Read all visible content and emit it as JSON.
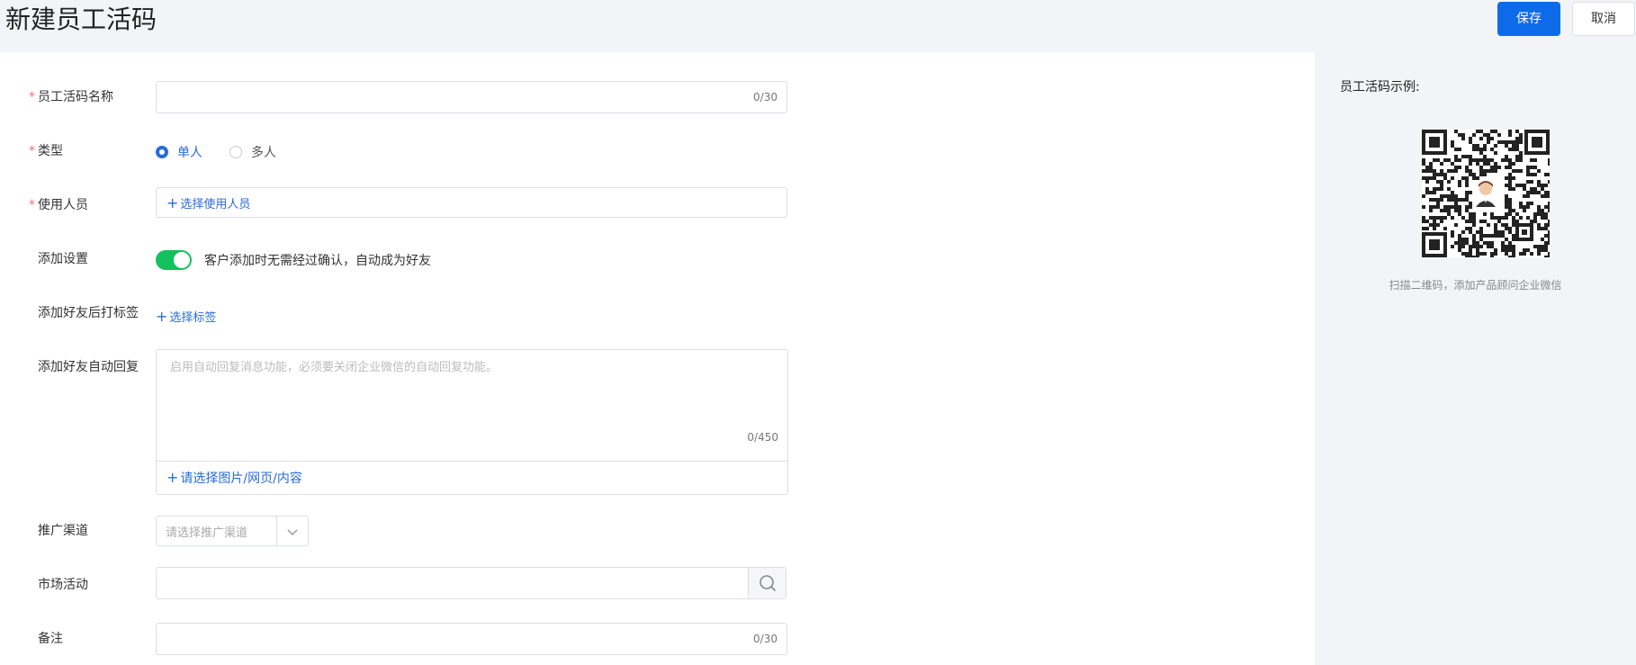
{
  "header": {
    "title": "新建员工活码",
    "save_label": "保存",
    "cancel_label": "取消"
  },
  "form": {
    "name": {
      "label": "员工活码名称",
      "required_mark": "*",
      "value": "",
      "counter": "0/30"
    },
    "type": {
      "label": "类型",
      "required_mark": "*",
      "options": [
        "单人",
        "多人"
      ],
      "selected": "单人"
    },
    "users": {
      "label": "使用人员",
      "required_mark": "*",
      "add_label": "选择使用人员"
    },
    "add_setting": {
      "label": "添加设置",
      "toggle_on": true,
      "toggle_text": "客户添加时无需经过确认，自动成为好友"
    },
    "tags": {
      "label": "添加好友后打标签",
      "add_label": "选择标签"
    },
    "auto_reply": {
      "label": "添加好友自动回复",
      "placeholder": "启用自动回复消息功能，必须要关闭企业微信的自动回复功能。",
      "counter": "0/450",
      "attach_label": "请选择图片/网页/内容"
    },
    "channel": {
      "label": "推广渠道",
      "placeholder": "请选择推广渠道"
    },
    "campaign": {
      "label": "市场活动",
      "value": ""
    },
    "remark": {
      "label": "备注",
      "value": "",
      "counter": "0/30"
    }
  },
  "side": {
    "example_title": "员工活码示例:",
    "caption": "扫描二维码，添加产品顾问企业微信"
  },
  "colors": {
    "primary": "#0d6bea",
    "link": "#2a6bd8",
    "switch_on": "#13c15e",
    "required": "#f56c6c",
    "panel_bg": "#f3f4f7"
  }
}
